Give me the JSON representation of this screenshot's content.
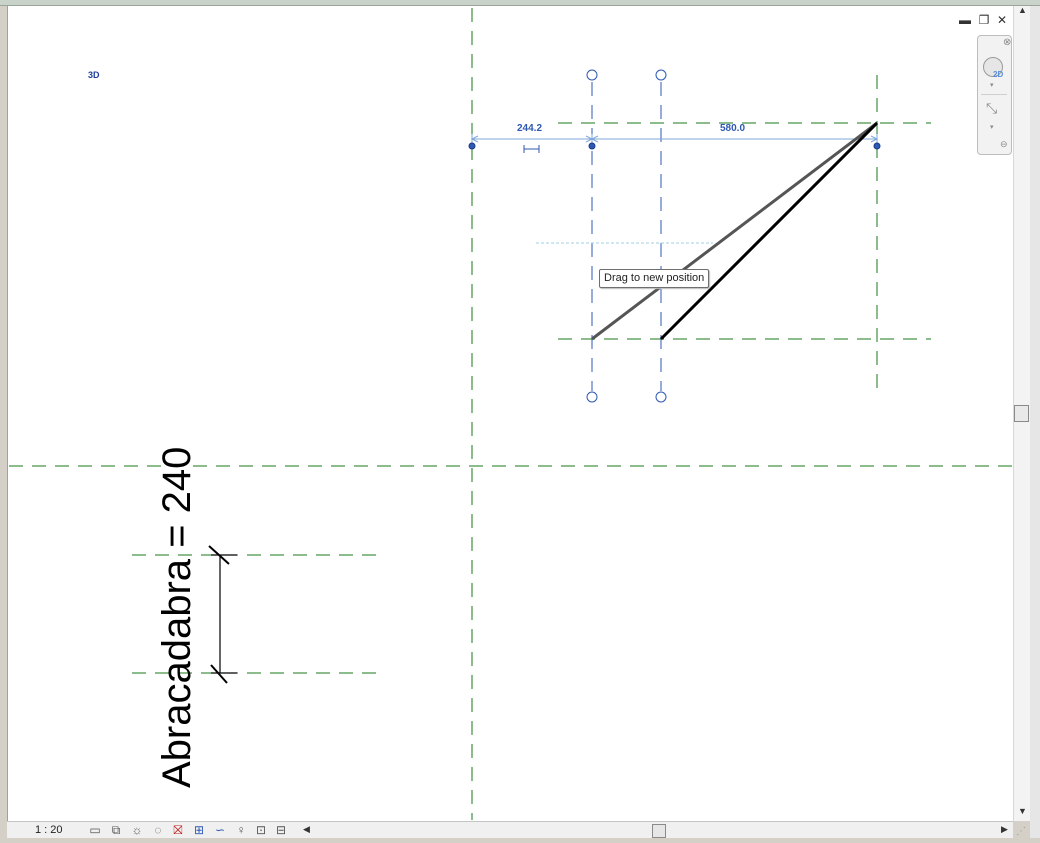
{
  "view": {
    "label_3d": "3D",
    "tooltip": "Drag to new position",
    "dim_left": "244.2",
    "dim_right": "580.0",
    "annotation": "Abracadabra = 240"
  },
  "window_controls": {
    "minimize_icon": "minimize-icon",
    "restore_icon": "restore-icon",
    "close_icon": "close-icon"
  },
  "navigation_bar": {
    "wheel_label": "2D",
    "icons": [
      "steering-wheel-icon",
      "zoom-region-icon"
    ]
  },
  "status_bar": {
    "scale": "1 : 20",
    "icons": [
      "detail-level-icon",
      "visual-style-icon",
      "sun-path-icon",
      "shadows-icon",
      "crop-view-icon",
      "show-crop-icon",
      "temporary-hide-icon",
      "reveal-hidden-icon",
      "analytical-model-icon",
      "highlight-displacement-icon"
    ]
  },
  "colors": {
    "ref_plane": "#1a7a1a",
    "selected": "#2f58b3",
    "line": "#000000",
    "line_grey": "#555555"
  }
}
